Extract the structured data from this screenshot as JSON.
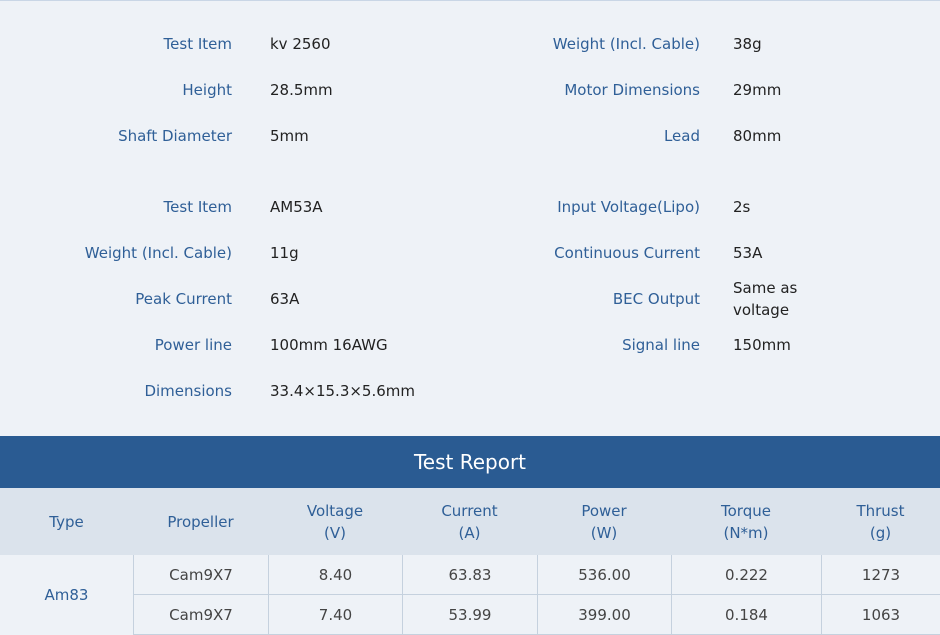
{
  "motor_specs": [
    {
      "label": "Test Item",
      "value": "kv 2560"
    },
    {
      "label": "Weight (Incl. Cable)",
      "value": "38g"
    },
    {
      "label": "Height",
      "value": "28.5mm"
    },
    {
      "label": "Motor Dimensions",
      "value": "29mm"
    },
    {
      "label": "Shaft Diameter",
      "value": "5mm"
    },
    {
      "label": "Lead",
      "value": "80mm"
    }
  ],
  "esc_specs": [
    {
      "label": "Test Item",
      "value": "AM53A"
    },
    {
      "label": "Input Voltage(Lipo)",
      "value": "2s"
    },
    {
      "label": "Weight (Incl. Cable)",
      "value": "11g"
    },
    {
      "label": "Continuous Current",
      "value": "53A"
    },
    {
      "label": "Peak Current",
      "value": "63A"
    },
    {
      "label": "BEC Output",
      "value": "Same as voltage"
    },
    {
      "label": "Power line",
      "value": "100mm 16AWG"
    },
    {
      "label": "Signal line",
      "value": "150mm"
    },
    {
      "label": "Dimensions",
      "value": "33.4×15.3×5.6mm"
    }
  ],
  "report": {
    "title": "Test Report",
    "columns": [
      {
        "name": "Type",
        "unit": ""
      },
      {
        "name": "Propeller",
        "unit": ""
      },
      {
        "name": "Voltage",
        "unit": "(V)"
      },
      {
        "name": "Current",
        "unit": "(A)"
      },
      {
        "name": "Power",
        "unit": "(W)"
      },
      {
        "name": "Torque",
        "unit": "(N*m)"
      },
      {
        "name": "Thrust",
        "unit": "(g)"
      }
    ],
    "type": "Am83",
    "rows": [
      [
        "Cam9X7",
        "8.40",
        "63.83",
        "536.00",
        "0.222",
        "1273"
      ],
      [
        "Cam9X7",
        "7.40",
        "53.99",
        "399.00",
        "0.184",
        "1063"
      ]
    ]
  },
  "colors": {
    "accent": "#2a5b92",
    "label": "#2f5f97",
    "background": "#eef2f7",
    "header_bg": "#dbe3ec"
  }
}
